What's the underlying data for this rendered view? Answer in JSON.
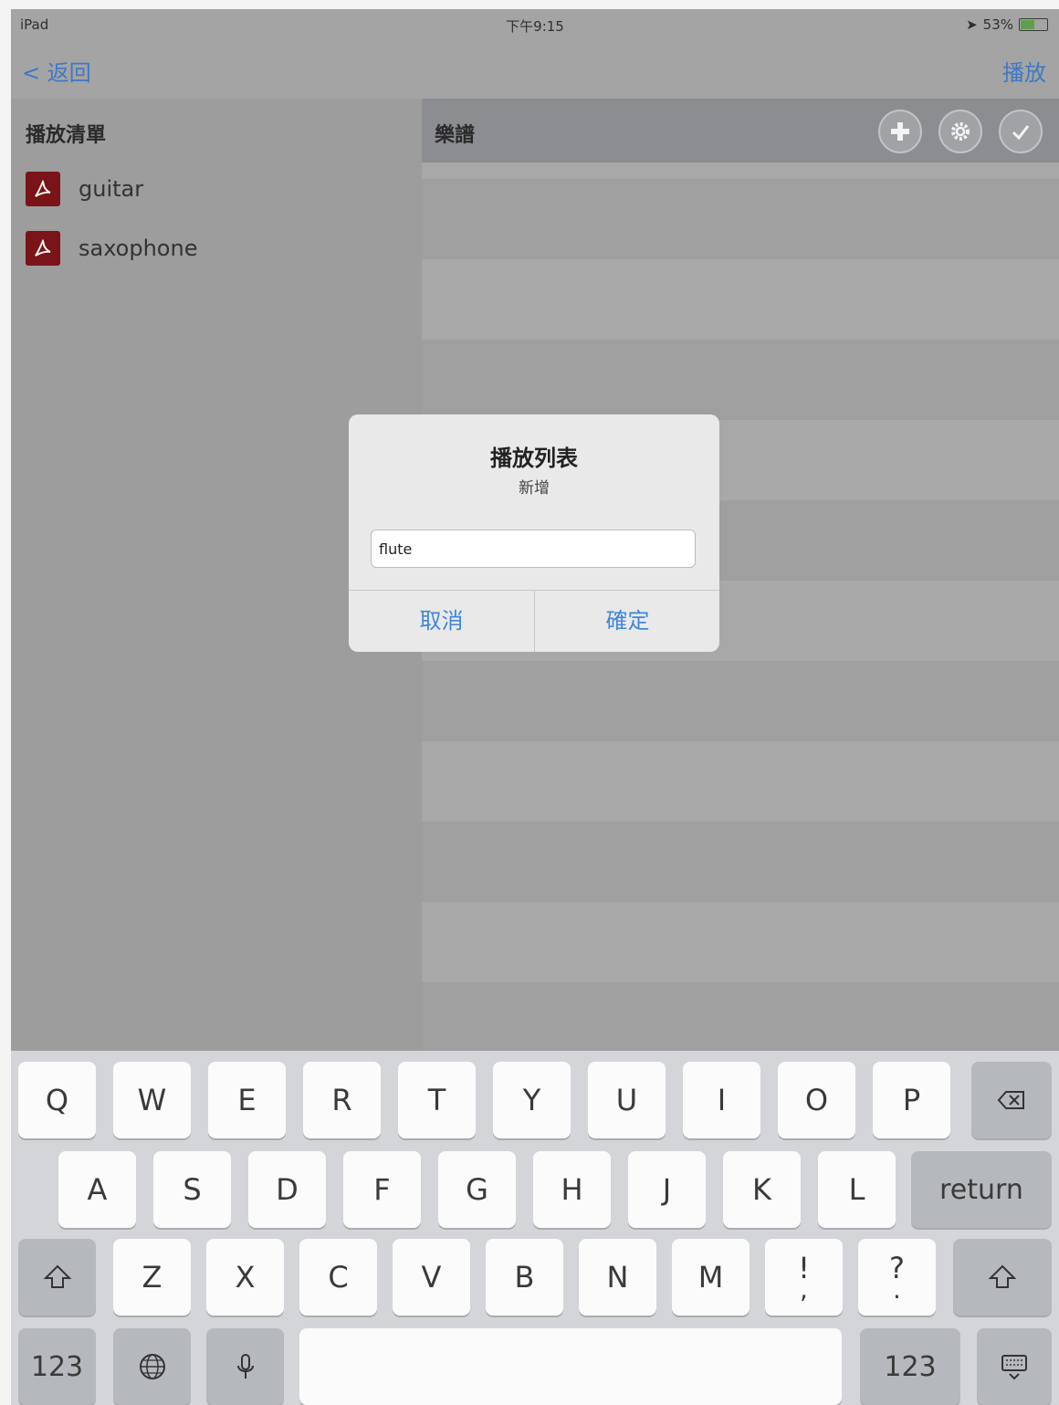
{
  "status_bar": {
    "device": "iPad",
    "time": "下午9:15",
    "battery": "53%"
  },
  "nav": {
    "back_label": "< 返回",
    "play_label": "播放"
  },
  "left_pane": {
    "header": "播放清單",
    "items": [
      {
        "label": "guitar"
      },
      {
        "label": "saxophone"
      }
    ]
  },
  "right_pane": {
    "header": "樂譜"
  },
  "dialog": {
    "title": "播放列表",
    "message": "新增",
    "input_value": "flute",
    "cancel_label": "取消",
    "confirm_label": "確定"
  },
  "keyboard": {
    "row1": [
      "Q",
      "W",
      "E",
      "R",
      "T",
      "Y",
      "U",
      "I",
      "O",
      "P"
    ],
    "row2": [
      "A",
      "S",
      "D",
      "F",
      "G",
      "H",
      "J",
      "K",
      "L"
    ],
    "return_label": "return",
    "row3": [
      "Z",
      "X",
      "C",
      "V",
      "B",
      "N",
      "M"
    ],
    "punct1": {
      "top": "!",
      "bottom": ","
    },
    "punct2": {
      "top": "?",
      "bottom": "."
    },
    "numbers_label": "123",
    "icons": [
      "backspace-icon",
      "shift-icon",
      "globe-icon",
      "microphone-icon",
      "keyboard-hide-icon"
    ]
  }
}
